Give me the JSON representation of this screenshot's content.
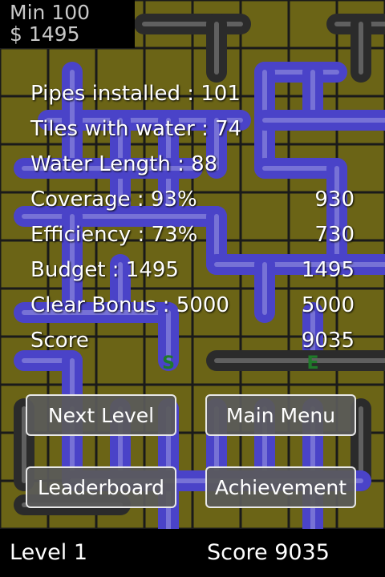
{
  "header": {
    "min": "Min 100",
    "money": "$ 1495"
  },
  "results": [
    {
      "label": "Pipes installed : 101",
      "value": ""
    },
    {
      "label": "Tiles with water : 74",
      "value": ""
    },
    {
      "label": "Water Length : 88",
      "value": ""
    },
    {
      "label": "Coverage : 93%",
      "value": "930"
    },
    {
      "label": "Efficiency : 73%",
      "value": "730"
    },
    {
      "label": "Budget : 1495",
      "value": "1495"
    },
    {
      "label": "Clear Bonus : 5000",
      "value": "5000"
    },
    {
      "label": "Score",
      "value": "9035"
    }
  ],
  "markers": {
    "start": "S",
    "end": "E"
  },
  "buttons": {
    "next_level": "Next Level",
    "main_menu": "Main Menu",
    "leaderboard": "Leaderboard",
    "achievement": "Achievement"
  },
  "footer": {
    "level": "Level 1",
    "score": "Score 9035"
  },
  "colors": {
    "tile": "#6b6416",
    "pipe_blue": "#4a43c8",
    "pipe_dark": "#2b2b2b",
    "grid_line": "#1a1a1a",
    "marker": "#1f7a2a"
  }
}
